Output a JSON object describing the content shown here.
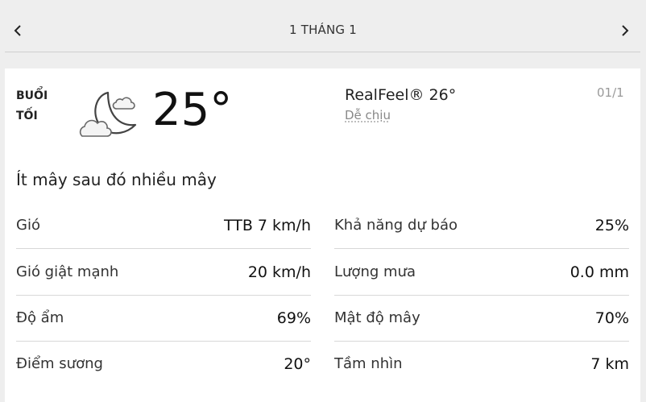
{
  "header": {
    "title": "1 THÁNG 1",
    "prev_icon": "chevron-left-icon",
    "next_icon": "chevron-right-icon"
  },
  "current": {
    "period": "BUỔI TỐI",
    "icon": "partly-cloudy-night-icon",
    "temperature": "25°",
    "realfeel": "RealFeel® 26°",
    "realfeel_phrase": "Dễ chịu",
    "date": "01/1",
    "phrase": "Ít mây sau đó nhiều mây"
  },
  "details_left": [
    {
      "label": "Gió",
      "value": "TTB 7 km/h"
    },
    {
      "label": "Gió giật mạnh",
      "value": "20 km/h"
    },
    {
      "label": "Độ ẩm",
      "value": "69%"
    },
    {
      "label": "Điểm sương",
      "value": "20°"
    }
  ],
  "details_right": [
    {
      "label": "Khả năng dự báo",
      "value": "25%"
    },
    {
      "label": "Lượng mưa",
      "value": "0.0 mm"
    },
    {
      "label": "Mật độ mây",
      "value": "70%"
    },
    {
      "label": "Tầm nhìn",
      "value": "7 km"
    }
  ]
}
